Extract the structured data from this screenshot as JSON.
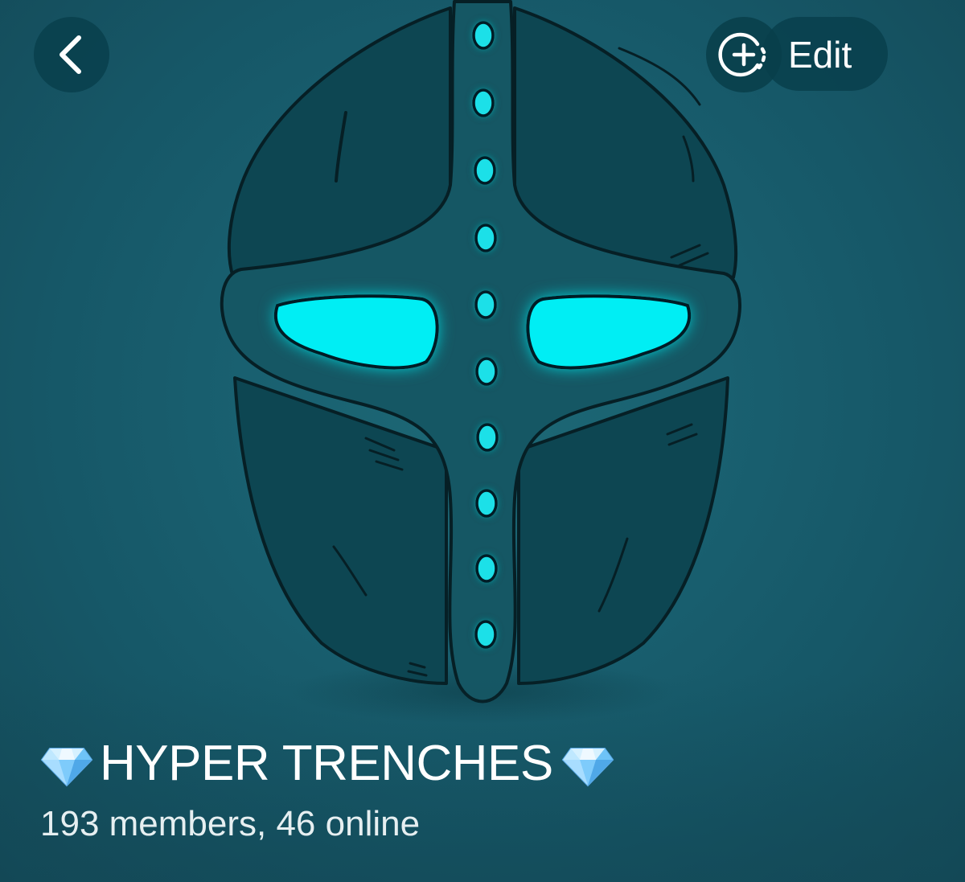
{
  "header": {
    "back_icon": "chevron-left-icon",
    "add_story_icon": "add-story-icon",
    "edit_label": "Edit"
  },
  "profile": {
    "avatar_description_icon": "knight-helmet-avatar",
    "title_prefix_icon": "gem-icon",
    "title": "HYPER TRENCHES",
    "title_suffix_icon": "gem-icon",
    "status": "193 members, 46 online"
  },
  "colors": {
    "background": "#196070",
    "helmet_fill": "#0f4a55",
    "glow": "#00f0f5",
    "button_bg": "#0a3f4b",
    "text": "#ffffff"
  }
}
